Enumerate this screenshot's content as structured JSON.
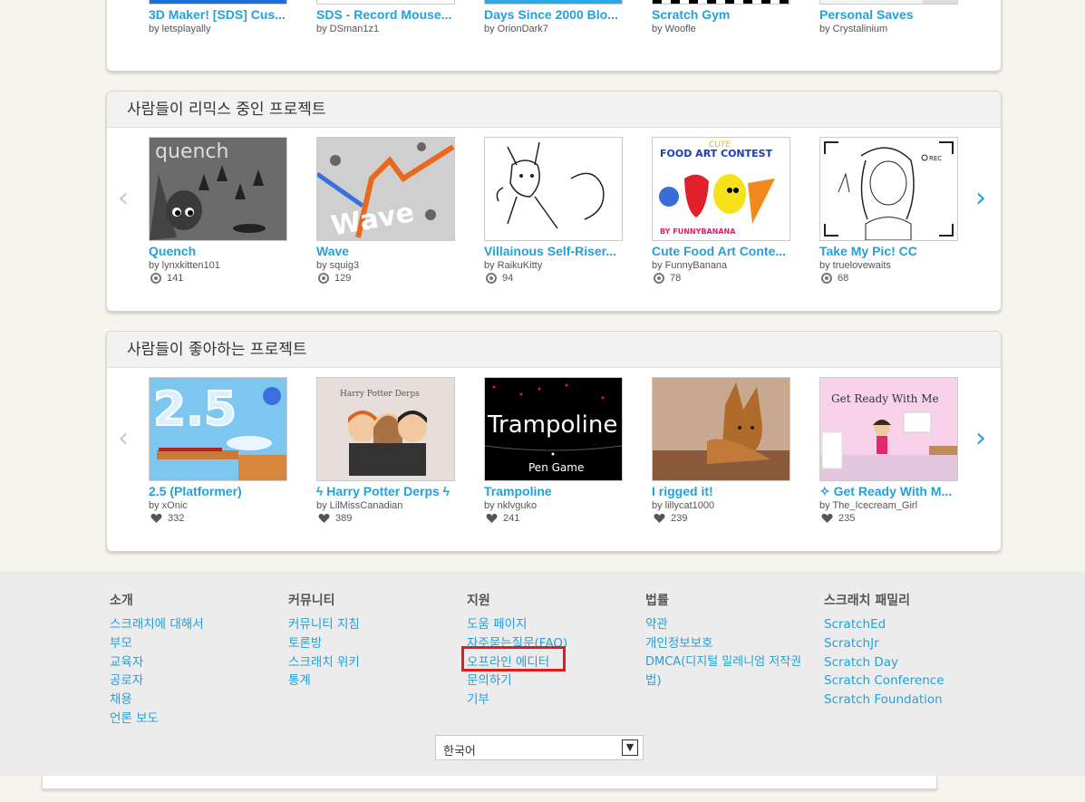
{
  "top_row": {
    "projects": [
      {
        "title": "3D Maker! [SDS] Cus...",
        "author": "by letsplayally"
      },
      {
        "title": "SDS - Record Mouse...",
        "author": "by DSman1z1"
      },
      {
        "title": "Days Since 2000 Blo...",
        "author": "by OrionDark7"
      },
      {
        "title": "Scratch Gym",
        "author": "by Woofle"
      },
      {
        "title": "Personal Saves",
        "author": "by Crystalinium"
      }
    ]
  },
  "remixed": {
    "heading": "사람들이 리믹스 중인 프로젝트",
    "projects": [
      {
        "title": "Quench",
        "author": "by lynxkitten101",
        "count": "141"
      },
      {
        "title": "Wave",
        "author": "by squig3",
        "count": "129"
      },
      {
        "title": "Villainous Self-Riser...",
        "author": "by RaikuKitty",
        "count": "94"
      },
      {
        "title": "Cute Food Art Conte...",
        "author": "by FunnyBanana",
        "count": "78"
      },
      {
        "title": "Take My Pic! CC",
        "author": "by truelovewaits",
        "count": "68"
      }
    ],
    "thumb_text": {
      "quench": "quench",
      "wave": "Wave",
      "food_1": "CUTE",
      "food_2": "FOOD ART CONTEST",
      "food_3": "BY FUNNYBANANA",
      "rec": "REC"
    }
  },
  "loved": {
    "heading": "사람들이 좋아하는 프로젝트",
    "projects": [
      {
        "title": "2.5 (Platformer)",
        "author": "by xOnic",
        "count": "332"
      },
      {
        "title": "ϟ Harry Potter Derps ϟ",
        "author": "by LilMissCanadian",
        "count": "389"
      },
      {
        "title": "Trampoline",
        "author": "by nklvguko",
        "count": "241"
      },
      {
        "title": "I rigged it!",
        "author": "by lillycat1000",
        "count": "239"
      },
      {
        "title": "✧ Get Ready With M...",
        "author": "by The_Icecream_Girl",
        "count": "235"
      }
    ],
    "thumb_text": {
      "platformer": "2.5",
      "hp": "Harry Potter Derps",
      "tramp_1": "Trampoline",
      "tramp_2": "Pen  Game",
      "grwm": "Get Ready With Me"
    }
  },
  "footer": {
    "columns": [
      {
        "heading": "소개",
        "links": [
          "스크래치에 대해서",
          "부모",
          "교육자",
          "공로자",
          "채용",
          "언론 보도"
        ]
      },
      {
        "heading": "커뮤니티",
        "links": [
          "커뮤니티 지침",
          "토론방",
          "스크래치 위키",
          "통계"
        ]
      },
      {
        "heading": "지원",
        "links": [
          "도움 페이지",
          "자주묻는질문(FAQ)",
          "오프라인 에디터",
          "문의하기",
          "기부"
        ]
      },
      {
        "heading": "법률",
        "links": [
          "약관",
          "개인정보보호",
          "DMCA(디지털 밀레니엄 저작권",
          "법)"
        ]
      },
      {
        "heading": "스크래치 패밀리",
        "links": [
          "ScratchEd",
          "ScratchJr",
          "Scratch Day",
          "Scratch Conference",
          "Scratch Foundation"
        ]
      }
    ],
    "language": "한국어"
  },
  "icons": {
    "remix": "remix-icon",
    "love": "heart-icon",
    "prev": "chevron-left-icon",
    "next": "chevron-right-icon"
  },
  "colors": {
    "link": "#25a0d8",
    "highlight": "#e01c1c"
  }
}
